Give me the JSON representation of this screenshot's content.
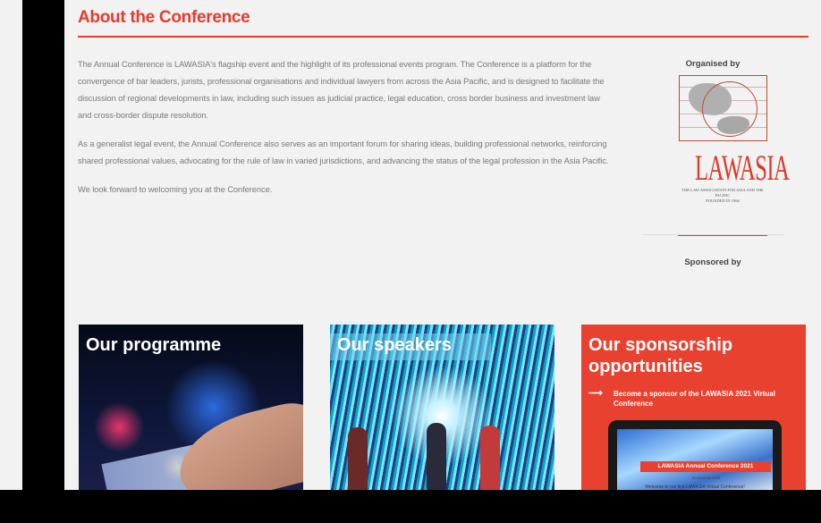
{
  "about": {
    "title": "About the Conference",
    "paragraphs": [
      "The Annual Conference is LAWASIA's flagship event and the highlight of its professional events program.  The Conference is a platform for the convergence of bar leaders, jurists, professional organisations and individual lawyers from across the Asia Pacific, and is designed to facilitate the discussion of regional developments in law, including such issues as judicial practice, legal education, cross border business and investment law and cross-border dispute resolution.",
      "As a generalist legal event, the Annual Conference also serves as an important forum for sharing ideas, building professional networks, reinforcing shared professional values, advocating for the rule of law in varied jurisdictions, and advancing the status of the legal profession in the Asia Pacific.",
      "We look forward to welcoming you at the Conference."
    ]
  },
  "sidebar": {
    "organised_label": "Organised by",
    "logo_word": "LAWASIA",
    "logo_subtitle": "THE LAW ASSOCIATION FOR ASIA AND THE PACIFIC",
    "logo_founded": "FOUNDED IN 1966",
    "sponsored_label": "Sponsored by"
  },
  "cards": {
    "programme": {
      "title": "Our programme"
    },
    "speakers": {
      "title": "Our speakers"
    },
    "sponsorship": {
      "title": "Our sponsorship opportunities",
      "arrow": "⟶",
      "subtitle": "Become a sponsor of the LAWASIA 2021 Virtual Conference",
      "banner": "LAWASIA Annual Conference 2021",
      "banner_sub": "November 2021",
      "welcome": "Welcome to our first LAWASIA Virtual Conference!"
    }
  },
  "colors": {
    "accent": "#e53b2c",
    "text": "#7a7a7a",
    "background": "#f2f2f2"
  }
}
